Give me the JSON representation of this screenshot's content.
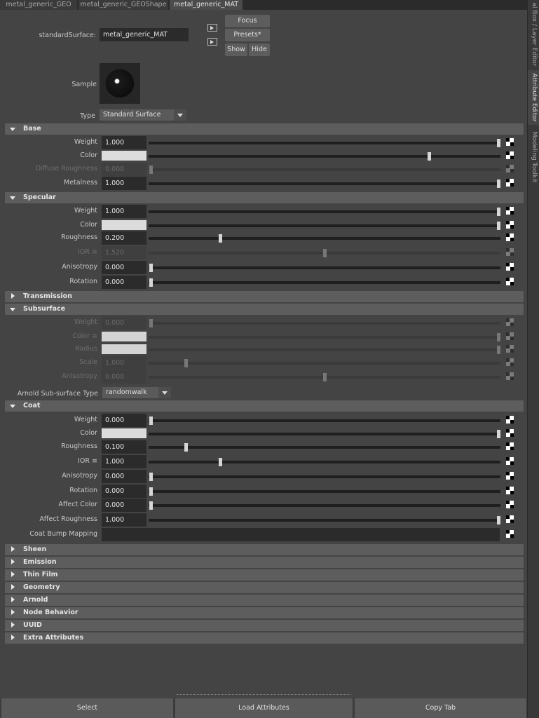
{
  "tabs": [
    "metal_generic_GEO",
    "metal_generic_GEOShape",
    "metal_generic_MAT"
  ],
  "active_tab": 2,
  "side_tabs": [
    "al Box / Layer Editor",
    "Attribute Editor",
    "Modeling Toolkit"
  ],
  "header": {
    "node_type_label": "standardSurface:",
    "node_name": "metal_generic_MAT",
    "focus_label": "Focus",
    "presets_label": "Presets*",
    "show_label": "Show",
    "hide_label": "Hide",
    "sample_label": "Sample",
    "type_label": "Type",
    "type_value": "Standard Surface"
  },
  "sections": {
    "base": {
      "title": "Base",
      "rows": [
        {
          "label": "Weight",
          "value": "1.000",
          "slider": 1.0
        },
        {
          "label": "Color",
          "color": "#dcdcdc",
          "slider": 0.8
        },
        {
          "label": "Diffuse Roughness",
          "value": "0.000",
          "slider": 0.0
        },
        {
          "label": "Metalness",
          "value": "1.000",
          "slider": 1.0
        }
      ]
    },
    "specular": {
      "title": "Specular",
      "rows": [
        {
          "label": "Weight",
          "value": "1.000",
          "slider": 1.0
        },
        {
          "label": "Color",
          "color": "#dcdcdc",
          "slider": 1.0
        },
        {
          "label": "Roughness",
          "value": "0.200",
          "slider": 0.2
        },
        {
          "label": "IOR ≡",
          "value": "1.520",
          "slider": 0.5
        },
        {
          "label": "Anisotropy",
          "value": "0.000",
          "slider": 0.0
        },
        {
          "label": "Rotation",
          "value": "0.000",
          "slider": 0.0
        }
      ]
    },
    "transmission": {
      "title": "Transmission"
    },
    "subsurface": {
      "title": "Subsurface",
      "rows": [
        {
          "label": "Weight",
          "value": "0.000",
          "slider": 0.0
        },
        {
          "label": "Color ≡",
          "color": "#d4d4d4",
          "slider": 1.0
        },
        {
          "label": "Radius",
          "color": "#d4d4d4",
          "slider": 1.0
        },
        {
          "label": "Scale",
          "value": "1.000",
          "slider": 0.1
        },
        {
          "label": "Anisotropy",
          "value": "0.000",
          "slider": 0.5
        }
      ],
      "sss_type_label": "Arnold Sub-surface Type",
      "sss_type_value": "randomwalk"
    },
    "coat": {
      "title": "Coat",
      "rows": [
        {
          "label": "Weight",
          "value": "0.000",
          "slider": 0.0
        },
        {
          "label": "Color",
          "color": "#dcdcdc",
          "slider": 1.0
        },
        {
          "label": "Roughness",
          "value": "0.100",
          "slider": 0.1
        },
        {
          "label": "IOR ≡",
          "value": "1.000",
          "slider": 0.2
        },
        {
          "label": "Anisotropy",
          "value": "0.000",
          "slider": 0.0
        },
        {
          "label": "Rotation",
          "value": "0.000",
          "slider": 0.0
        },
        {
          "label": "Affect Color",
          "value": "0.000",
          "slider": 0.0
        },
        {
          "label": "Affect Roughness",
          "value": "1.000",
          "slider": 1.0
        }
      ],
      "bump_label": "Coat Bump Mapping"
    },
    "collapsed": [
      "Sheen",
      "Emission",
      "Thin Film",
      "Geometry",
      "Arnold",
      "Node Behavior",
      "UUID",
      "Extra Attributes"
    ]
  },
  "bottom": {
    "select_label": "Select",
    "load_label": "Load Attributes",
    "copy_label": "Copy Tab"
  }
}
